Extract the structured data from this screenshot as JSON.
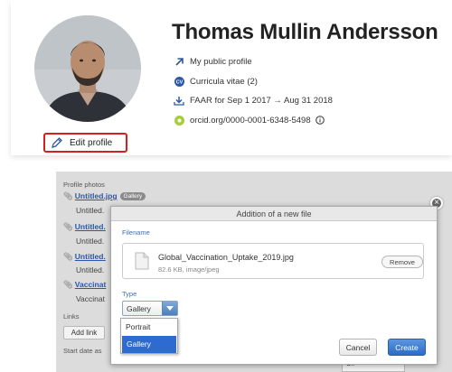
{
  "profile": {
    "name": "Thomas Mullin Andersson",
    "links": {
      "public_profile": "My public profile",
      "cv": "Curricula vitae (2)",
      "faar": "FAAR for Sep 1 2017 → Aug 31 2018",
      "orcid": "orcid.org/0000-0001-6348-5498"
    },
    "edit_label": "Edit profile",
    "icons": [
      "arrow-up-right-icon",
      "cv-icon",
      "download-icon",
      "orcid-icon",
      "info-icon",
      "pencil-icon"
    ],
    "colors": {
      "accent": "#2d57a8",
      "highlight_border": "#d42020",
      "orcid": "#a6ce39"
    }
  },
  "panel": {
    "photos_label": "Profile photos",
    "files": [
      {
        "name": "Untitled.jpg",
        "tag": "Gallery",
        "sub": "Untitled."
      },
      {
        "name": "Untitled.",
        "sub": "Untitled."
      },
      {
        "name": "Untitled.",
        "sub": "Untitled."
      },
      {
        "name": "Vaccinat",
        "sub": "Vaccinat"
      }
    ],
    "links_label": "Links",
    "add_link_label": "Add link",
    "start_date_label": "Start date as",
    "right_field_fragment": "Off"
  },
  "modal": {
    "title": "Addition of a new file",
    "filename_label": "Filename",
    "file": {
      "name": "Global_Vaccination_Uptake_2019.jpg",
      "meta": "82.6 KB, image/jpeg"
    },
    "remove_label": "Remove",
    "type_label": "Type",
    "type_selected": "Gallery",
    "type_options": [
      "Portrait",
      "Gallery"
    ],
    "cancel_label": "Cancel",
    "create_label": "Create",
    "colors": {
      "primary": "#2f6bc4",
      "selected_option": "#2e6bd1"
    }
  }
}
